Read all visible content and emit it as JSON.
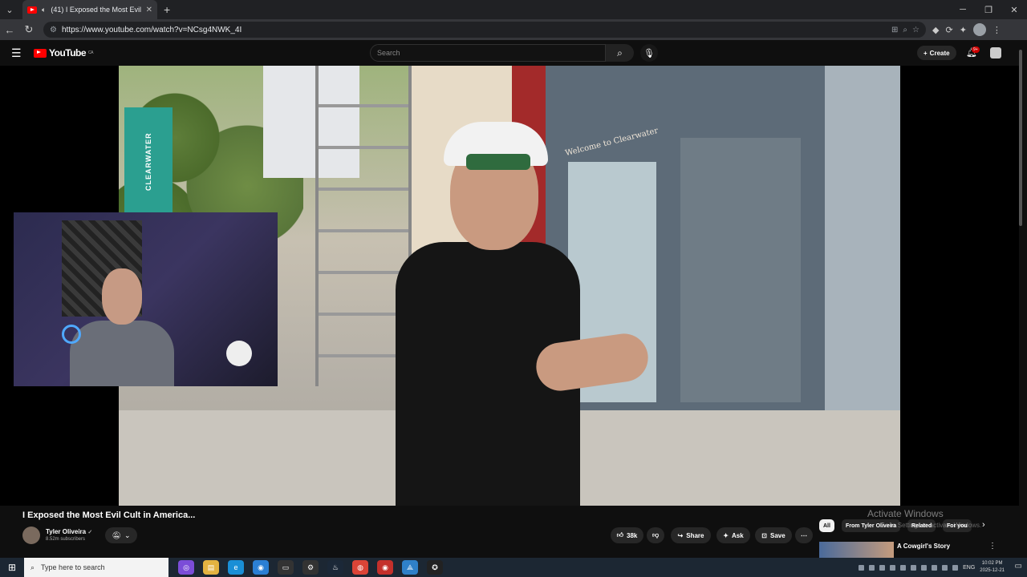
{
  "browser": {
    "tab_title": "(41) I Exposed the Most Evil",
    "url": "https://www.youtube.com/watch?v=NCsg4NWK_4I"
  },
  "youtube": {
    "logo_text": "YouTube",
    "country_code": "CA",
    "search_placeholder": "Search",
    "create_label": "Create",
    "notifications_badge": "9+"
  },
  "video": {
    "banner_text": "CLEARWATER",
    "storefront_sign": "Welcome to Clearwater",
    "title": "I Exposed the Most Evil Cult in America...",
    "channel_name": "Tyler Oliveira",
    "subscribers": "8.52m subscribers",
    "likes": "38k",
    "share_label": "Share",
    "ask_label": "Ask",
    "save_label": "Save"
  },
  "sidebar": {
    "chips": [
      "All",
      "From Tyler Oliveira",
      "Related",
      "For you"
    ],
    "first_recommendation_title": "A Cowgirl's Story"
  },
  "watermark": {
    "title": "Activate Windows",
    "subtitle": "Go to Settings to activate Windows."
  },
  "taskbar": {
    "search_placeholder": "Type here to search",
    "language": "ENG",
    "time": "10:02 PM",
    "date": "2025-12-21"
  }
}
